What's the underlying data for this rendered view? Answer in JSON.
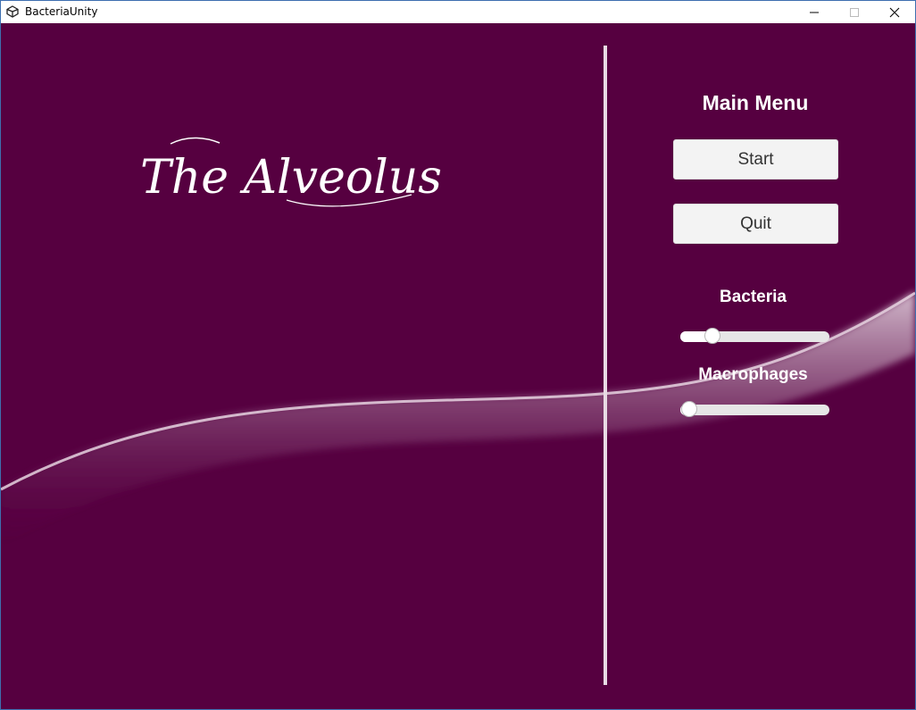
{
  "window": {
    "title": "BacteriaUnity",
    "controls": [
      "minimize-icon",
      "maximize-icon",
      "close-icon"
    ]
  },
  "game": {
    "title": "The Alveolus"
  },
  "menu": {
    "heading": "Main Menu",
    "start_label": "Start",
    "quit_label": "Quit"
  },
  "sliders": {
    "bacteria": {
      "label": "Bacteria",
      "value_fraction": 0.18
    },
    "macrophages": {
      "label": "Macrophages",
      "value_fraction": 0.0
    }
  },
  "colors": {
    "background": "#560040",
    "divider": "#e8dbe4",
    "button": "#f3f3f3",
    "text": "#ffffff"
  }
}
